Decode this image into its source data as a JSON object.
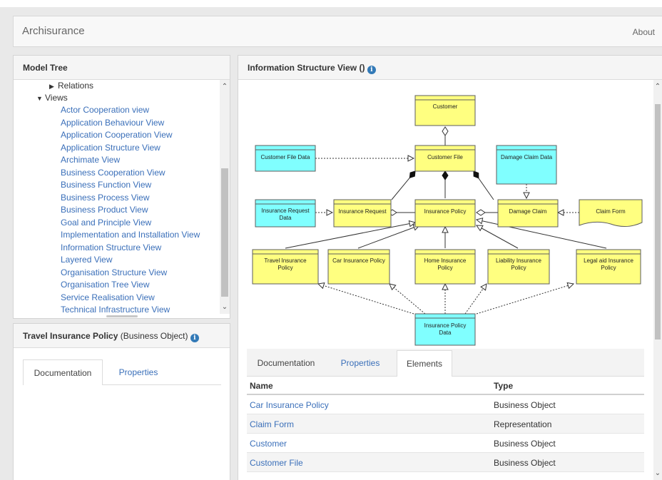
{
  "app": {
    "title": "Archisurance",
    "about": "About"
  },
  "model_tree": {
    "title": "Model Tree",
    "relations_label": "Relations",
    "views_label": "Views",
    "views": [
      "Actor Cooperation view",
      "Application Behaviour View",
      "Application Cooperation View",
      "Application Structure View",
      "Archimate View",
      "Business Cooperation View",
      "Business Function View",
      "Business Process View",
      "Business Product View",
      "Goal and Principle View",
      "Implementation and Installation View",
      "Information Structure View",
      "Layered View",
      "Organisation Structure View",
      "Organisation Tree View",
      "Service Realisation View",
      "Technical Infrastructure View"
    ]
  },
  "properties_panel": {
    "element_name": "Travel Insurance Policy",
    "element_type": "(Business Object)",
    "tabs": [
      "Documentation",
      "Properties"
    ],
    "active_tab": "Documentation"
  },
  "view": {
    "title": "Information Structure View ()",
    "diagram_nodes": {
      "customer": "Customer",
      "customer_file": "Customer File",
      "customer_file_data": "Customer File Data",
      "damage_claim_data": "Damage Claim Data",
      "insurance_request_data_1": "Insurance Request",
      "insurance_request_data_2": "Data",
      "insurance_request": "Insurance Request",
      "insurance_policy": "Insurance Policy",
      "damage_claim": "Damage Claim",
      "claim_form": "Claim Form",
      "travel_1": "Travel  Insurance",
      "travel_2": "Policy",
      "car": "Car Insurance Policy",
      "home_1": "Home Insurance",
      "home_2": "Policy",
      "liability_1": "Liability  Insurance",
      "liability_2": "Policy",
      "legal_1": "Legal aid  Insurance",
      "legal_2": "Policy",
      "ipdata_1": "Insurance Policy",
      "ipdata_2": "Data"
    },
    "colors": {
      "business_object": "#ffff80",
      "data_object": "#80ffff",
      "border": "#5c5c5c"
    },
    "tabs": [
      "Documentation",
      "Properties",
      "Elements"
    ],
    "active_tab": "Elements",
    "table": {
      "headers": [
        "Name",
        "Type"
      ],
      "rows": [
        [
          "Car Insurance Policy",
          "Business Object"
        ],
        [
          "Claim Form",
          "Representation"
        ],
        [
          "Customer",
          "Business Object"
        ],
        [
          "Customer File",
          "Business Object"
        ]
      ]
    }
  }
}
